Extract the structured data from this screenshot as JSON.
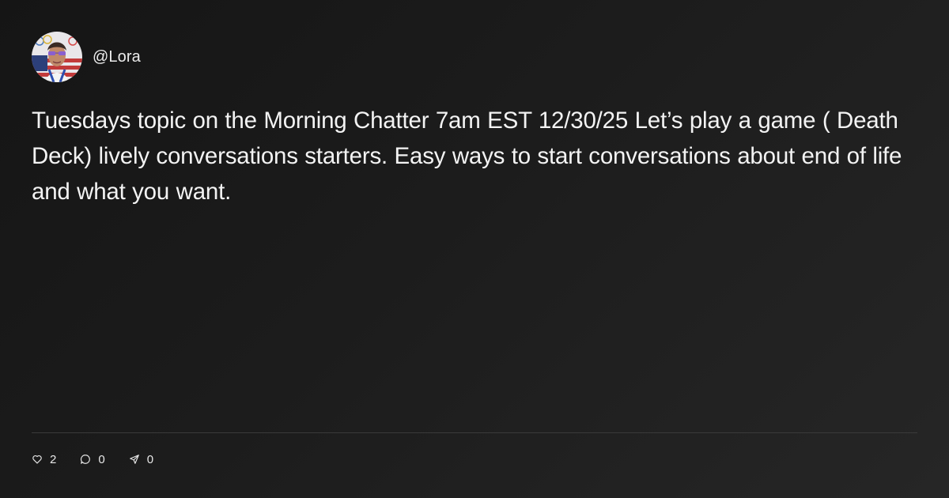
{
  "author": {
    "handle": "@Lora",
    "avatar_icon": "profile-photo"
  },
  "post": {
    "text": "Tuesdays topic on the Morning Chatter 7am EST 12/30/25 Let’s play a game ( Death Deck) lively conversations starters. Easy ways to start conversations about end of life and what you want."
  },
  "actions": {
    "likes": {
      "icon": "heart-icon",
      "count": "2"
    },
    "comments": {
      "icon": "comment-icon",
      "count": "0"
    },
    "shares": {
      "icon": "send-icon",
      "count": "0"
    }
  },
  "colors": {
    "background": "#1c1c1c",
    "text": "#f3f3f3",
    "divider": "#3a3a3a"
  }
}
